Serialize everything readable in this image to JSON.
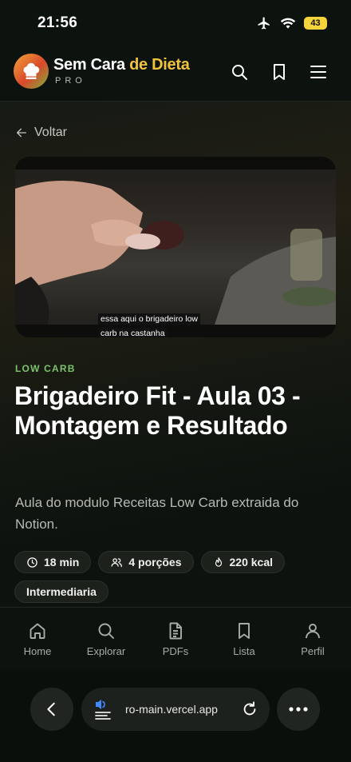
{
  "status_bar": {
    "time": "21:56",
    "battery": "43"
  },
  "brand": {
    "name_part1": "Sem Cara ",
    "name_part2": "de Dieta",
    "sub": "PRO"
  },
  "nav": {
    "back_label": "Voltar"
  },
  "video": {
    "caption_line1": "essa aqui o brigadeiro low",
    "caption_line2": "carb na castanha"
  },
  "lesson": {
    "category": "LOW CARB",
    "title": "Brigadeiro Fit - Aula 03 - Montagem e Resultado",
    "description": "Aula do modulo Receitas Low Carb extraida do Notion.",
    "chips": {
      "time": "18 min",
      "portions": "4 porções",
      "calories": "220 kcal",
      "level": "Intermediaria"
    }
  },
  "bottom_nav": [
    {
      "label": "Home",
      "icon": "home-icon"
    },
    {
      "label": "Explorar",
      "icon": "search-icon"
    },
    {
      "label": "PDFs",
      "icon": "document-icon"
    },
    {
      "label": "Lista",
      "icon": "bookmark-icon"
    },
    {
      "label": "Perfil",
      "icon": "user-icon"
    }
  ],
  "browser": {
    "url": "ro-main.vercel.app"
  },
  "colors": {
    "accent_green": "#7cc36b",
    "brand_yellow": "#f0c23e",
    "battery": "#f5d33a"
  }
}
